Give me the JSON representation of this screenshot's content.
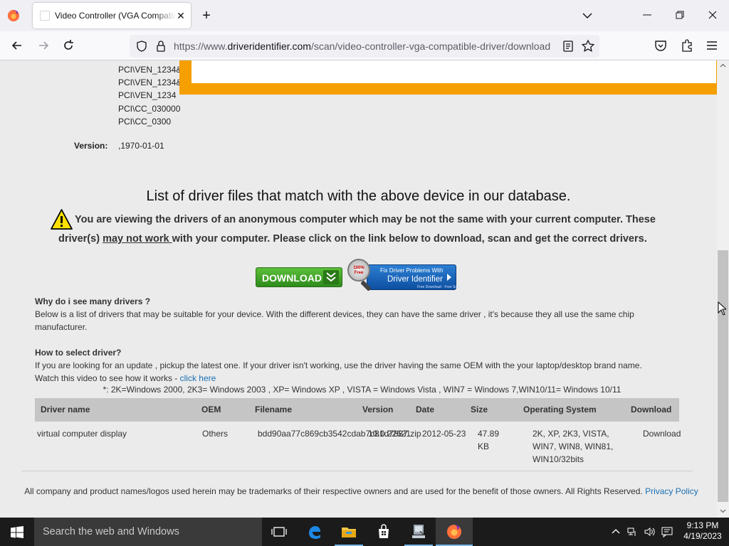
{
  "browser": {
    "tab_title": "Video Controller (VGA Compatible)",
    "url_prefix": "https://www.",
    "url_domain": "driveridentifier.com",
    "url_path": "/scan/video-controller-vga-compatible-driver/download"
  },
  "device": {
    "hardware_ids": [
      "PCI\\VEN_1234&",
      "PCI\\VEN_1234&",
      "PCI\\VEN_1234",
      "PCI\\CC_030000",
      "PCI\\CC_0300"
    ],
    "version_label": "Version:",
    "version_value": ",1970-01-01"
  },
  "content": {
    "heading": "List of driver files that match with the above device in our database.",
    "warning_line1": "You are viewing the drivers of an anonymous computer which may be not the same with your current computer. These",
    "warning_prefix": "driver(s) ",
    "warning_link": "may not work ",
    "warning_suffix": "with your computer. Please click on the link below to download, scan and get the correct drivers.",
    "download_button": "DOWNLOAD",
    "fix_badge": "100% Free",
    "fix_small": "Fix Driver Problems With",
    "fix_big": "Driver Identifier",
    "fix_tiny": "Free Download · Free Scan",
    "why_title": "Why do i see many drivers ?",
    "why_text": "Below is a list of drivers that may be suitable for your device. With the different devices, they can have the same driver , it's because they all use the same chip manufacturer.",
    "how_title": "How to select driver?",
    "how_text": "If you are looking for an update , pickup the latest one. If your driver isn't working, use the driver having the same OEM with the your laptop/desktop brand name.",
    "video_text": "Watch this video to see how it works - ",
    "video_link": "click here",
    "os_note": "*: 2K=Windows 2000, 2K3= Windows 2003 , XP= Windows XP , VISTA = Windows Vista , WIN7 = Windows 7,WIN10/11= Windows 10/11"
  },
  "table": {
    "headers": [
      "Driver name",
      "OEM",
      "Filename",
      "Version",
      "Date",
      "Size",
      "Operating System",
      "Download"
    ],
    "rows": [
      {
        "name": "virtual computer display",
        "oem": "Others",
        "filename": "bdd90aa77c869cb3542cdab7c81d7887.zip",
        "version": "10.0.22621",
        "date": "2012-05-23",
        "size": "47.89 KB",
        "os": "2K, XP, 2K3, VISTA, WIN7, WIN8, WIN81, WIN10/32bits",
        "download": "Download"
      }
    ]
  },
  "footer": {
    "text": "All company and product names/logos used herein may be trademarks of their respective owners and are used for the benefit of those owners. All Rights Reserved. ",
    "link": "Privacy Policy"
  },
  "taskbar": {
    "search_placeholder": "Search the web and Windows",
    "time": "9:13 PM",
    "date": "4/19/2023"
  }
}
